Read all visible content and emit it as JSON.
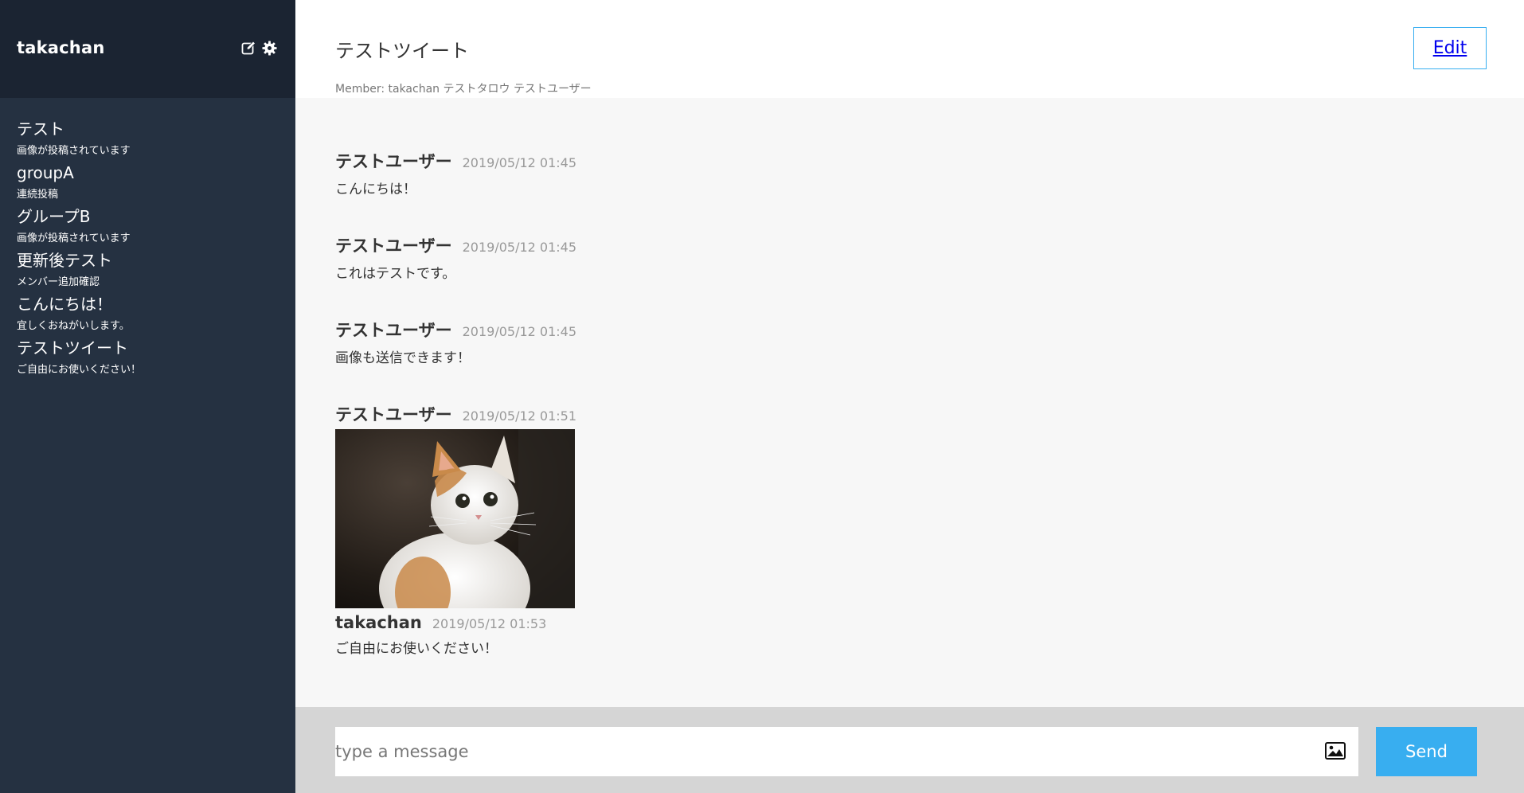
{
  "sidebar": {
    "user_name": "takachan",
    "groups": [
      {
        "name": "テスト",
        "last_message": "画像が投稿されています"
      },
      {
        "name": "groupA",
        "last_message": "連続投稿"
      },
      {
        "name": "グループB",
        "last_message": "画像が投稿されています"
      },
      {
        "name": "更新後テスト",
        "last_message": "メンバー追加確認"
      },
      {
        "name": "こんにちは！",
        "last_message": "宜しくおねがいします。"
      },
      {
        "name": "テストツイート",
        "last_message": "ご自由にお使いください！"
      }
    ]
  },
  "header": {
    "title": "テストツイート",
    "members": "Member: takachan テストタロウ テストユーザー",
    "edit_label": "Edit"
  },
  "messages": [
    {
      "user": "テストユーザー",
      "date": "2019/05/12 01:45",
      "text": "こんにちは！"
    },
    {
      "user": "テストユーザー",
      "date": "2019/05/12 01:45",
      "text": "これはテストです。"
    },
    {
      "user": "テストユーザー",
      "date": "2019/05/12 01:45",
      "text": "画像も送信できます！"
    },
    {
      "user": "テストユーザー",
      "date": "2019/05/12 01:51",
      "text": ""
    },
    {
      "user": "takachan",
      "date": "2019/05/12 01:53",
      "text": "ご自由にお使いください！"
    }
  ],
  "form": {
    "placeholder": "type a message",
    "send_label": "Send"
  },
  "colors": {
    "sidebar_bg": "#253141",
    "sidebar_header_bg": "#1b2432",
    "accent": "#38aef0"
  },
  "icons": {
    "edit": "edit-icon",
    "settings": "gear-icon",
    "image_upload": "image-icon"
  }
}
